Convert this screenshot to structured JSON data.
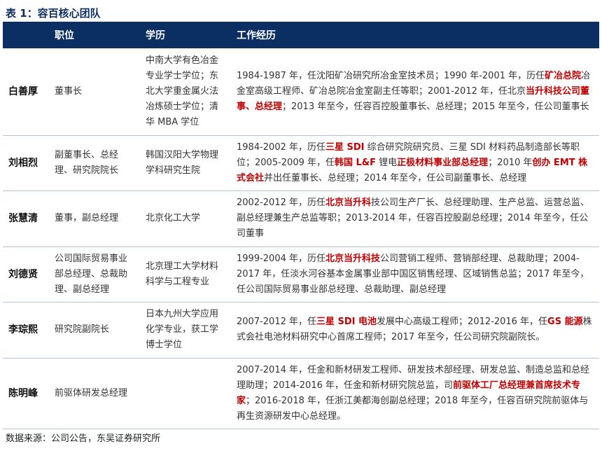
{
  "title": "表 1：容百核心团队",
  "headers": {
    "name": "",
    "position": "职位",
    "education": "学历",
    "experience": "工作经历"
  },
  "rows": [
    {
      "name": "白善厚",
      "position": "董事长",
      "education": "中南大学有色冶金专业学士学位；东北大学重金属火法冶炼硕士学位；清华 MBA 学位",
      "experience": [
        {
          "text": "1984-1987 年，任沈阳矿冶研究所冶金室技术员；1990 年-2001 年，历任",
          "highlight": false
        },
        {
          "text": "矿冶总院",
          "highlight": true
        },
        {
          "text": "冶金室高级工程师、矿冶总院冶金室副主任等职；2001-2012 年，任北京",
          "highlight": false
        },
        {
          "text": "当升科技",
          "highlight": true
        },
        {
          "text": "公司董事、总经理",
          "highlight": true
        },
        {
          "text": "；2013 年至今，任容百控股董事长、总经理；2015 年至今，任公司董事长",
          "highlight": false
        }
      ]
    },
    {
      "name": "刘相烈",
      "position": "副董事长、总经理、研究院院长",
      "education": "韩国汉阳大学物理学科研究生院",
      "experience": [
        {
          "text": "1984-2002 年，历任",
          "highlight": false
        },
        {
          "text": "三星 SDI",
          "highlight": true
        },
        {
          "text": " 综合研究院研究员、三星 SDI 材料药品制造部长等职位；2005-2009 年，任",
          "highlight": false
        },
        {
          "text": "韩国 L&F",
          "highlight": true
        },
        {
          "text": " 锂电",
          "highlight": false
        },
        {
          "text": "正极材料事业部总经理",
          "highlight": true
        },
        {
          "text": "；2010 年",
          "highlight": false
        },
        {
          "text": "创办 EMT 株式会社",
          "highlight": true
        },
        {
          "text": "并出任董事长、总经理；2014 年至今，任公司副董事长、总经理",
          "highlight": false
        }
      ]
    },
    {
      "name": "张慧清",
      "position": "董事，副总经理",
      "education": "北京化工大学",
      "experience": [
        {
          "text": "2002-2012 年，历任",
          "highlight": false
        },
        {
          "text": "北京当升科",
          "highlight": true
        },
        {
          "text": "技公司生产厂长、总经理助理、生产总监、运营总监、副总经理兼生产总监等职；2013-2014 年，任容百控股副总经理；2014 年至今，任公司董事",
          "highlight": false
        }
      ]
    },
    {
      "name": "刘德贤",
      "position": "公司国际贸易事业部总经理、总裁助理、副总经理",
      "education": "北京理工大学材料科学与工程专业",
      "experience": [
        {
          "text": "1999-2004 年，历任",
          "highlight": false
        },
        {
          "text": "北京当升科技",
          "highlight": true
        },
        {
          "text": "公司营销工程师、营销部经理、总裁助理；2004-2017 年，任淡水河谷基本金属事业部中国区销售经理、区域销售总监；2017 年至今，任公司国际贸易事业部总经理、总裁助理、副总经理",
          "highlight": false
        }
      ]
    },
    {
      "name": "李琮熙",
      "position": "研究院副院长",
      "education": "日本九州大学应用化学专业，获工学博士学位",
      "experience": [
        {
          "text": "2007-2012 年，任",
          "highlight": false
        },
        {
          "text": "三星 SDI 电池",
          "highlight": true
        },
        {
          "text": "发展中心高级工程师；2012-2016 年，任",
          "highlight": false
        },
        {
          "text": "GS 能源",
          "highlight": true
        },
        {
          "text": "株式会社电池材料研究中心首席工程师；2017 年至今，任公司研究院副院长。",
          "highlight": false
        }
      ]
    },
    {
      "name": "陈明峰",
      "position": "前驱体研发总经理",
      "education": "",
      "experience": [
        {
          "text": "2007-2014 年，任金和新材研发工程师、研发技术部经理、研发总监、制造总监和总经理助理；2014-2016 年，任金和新材研究院总监，司",
          "highlight": false
        },
        {
          "text": "前驱体工厂总经理兼首席技术专家",
          "highlight": true
        },
        {
          "text": "；2016-2018 年，任浙江美都海创副总经理；2018 年至今，任容百研究院前驱体与再生资源研发中心总经理。",
          "highlight": false
        }
      ]
    }
  ],
  "source": "数据来源：公司公告，东吴证券研究所"
}
